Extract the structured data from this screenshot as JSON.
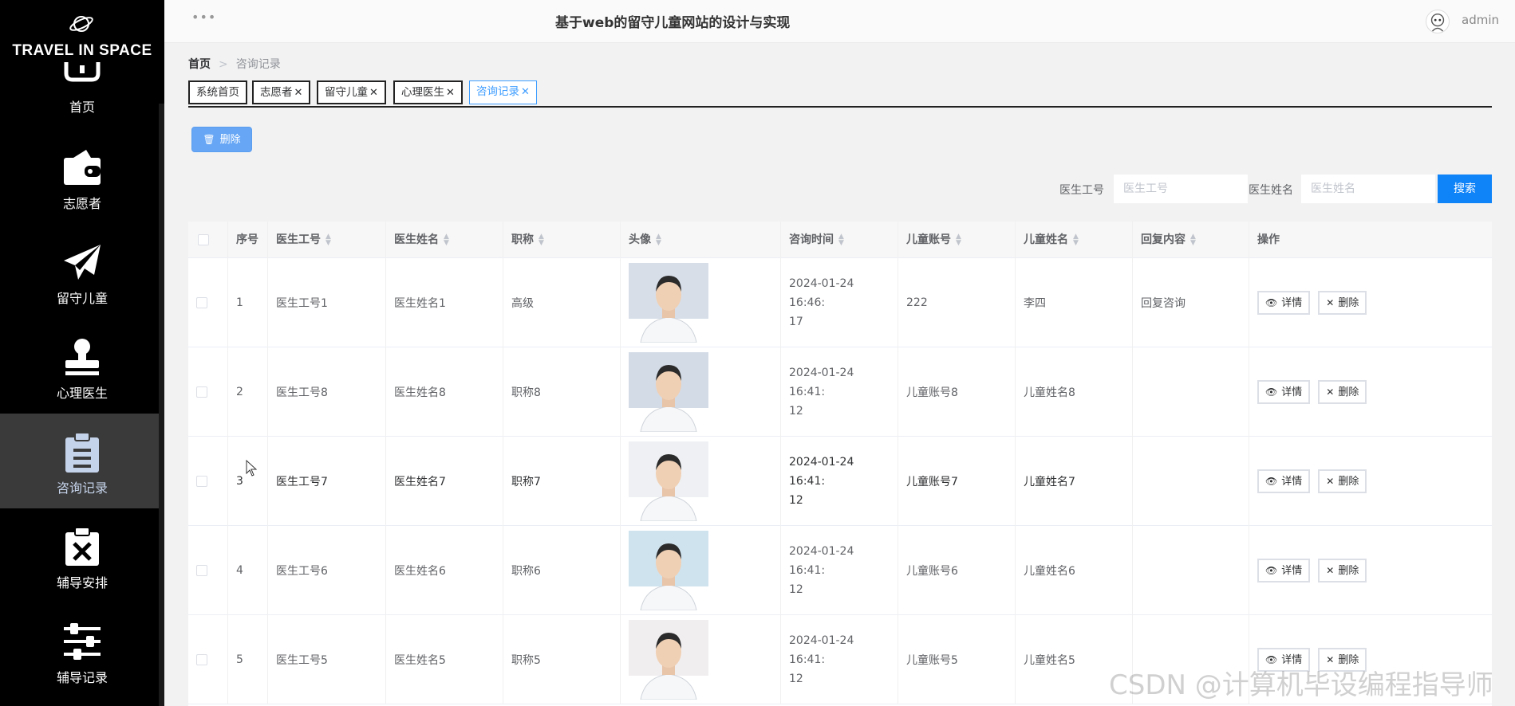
{
  "brand": {
    "title": "TRAVEL IN SPACE",
    "icon": "planet-icon"
  },
  "sidebar": {
    "items": [
      {
        "label": "首页",
        "icon": "home-icon",
        "active": false
      },
      {
        "label": "志愿者",
        "icon": "wallet-icon",
        "active": false
      },
      {
        "label": "留守儿童",
        "icon": "paper-plane-icon",
        "active": false
      },
      {
        "label": "心理医生",
        "icon": "stamp-icon",
        "active": false
      },
      {
        "label": "咨询记录",
        "icon": "clipboard-icon",
        "active": true
      },
      {
        "label": "辅导安排",
        "icon": "clipboard-x-icon",
        "active": false
      },
      {
        "label": "辅导记录",
        "icon": "sliders-icon",
        "active": false
      }
    ]
  },
  "header": {
    "dots": "•••",
    "site_title": "基于web的留守儿童网站的设计与实现",
    "user": "admin"
  },
  "breadcrumb": {
    "home": "首页",
    "separator": ">",
    "current": "咨询记录"
  },
  "tabs": [
    {
      "label": "系统首页",
      "closable": false,
      "active": false
    },
    {
      "label": "志愿者",
      "closable": true,
      "active": false
    },
    {
      "label": "留守儿童",
      "closable": true,
      "active": false
    },
    {
      "label": "心理医生",
      "closable": true,
      "active": false
    },
    {
      "label": "咨询记录",
      "closable": true,
      "active": true
    }
  ],
  "toolbar": {
    "delete_label": "删除",
    "delete_icon": "trash-icon"
  },
  "search": {
    "doctor_id_label": "医生工号",
    "doctor_id_placeholder": "医生工号",
    "doctor_name_label": "医生姓名",
    "doctor_name_placeholder": "医生姓名",
    "button_label": "搜索"
  },
  "table": {
    "columns": [
      "序号",
      "医生工号",
      "医生姓名",
      "职称",
      "头像",
      "咨询时间",
      "儿童账号",
      "儿童姓名",
      "回复内容",
      "操作"
    ],
    "rows": [
      {
        "index": "1",
        "doctor_id": "医生工号1",
        "doctor_name": "医生姓名1",
        "title": "高级",
        "time_line1": "2024-01-24 16:46:",
        "time_line2": "17",
        "child_account": "222",
        "child_name": "李四",
        "reply": "回复咨询"
      },
      {
        "index": "2",
        "doctor_id": "医生工号8",
        "doctor_name": "医生姓名8",
        "title": "职称8",
        "time_line1": "2024-01-24 16:41:",
        "time_line2": "12",
        "child_account": "儿童账号8",
        "child_name": "儿童姓名8",
        "reply": ""
      },
      {
        "index": "3",
        "doctor_id": "医生工号7",
        "doctor_name": "医生姓名7",
        "title": "职称7",
        "time_line1": "2024-01-24 16:41:",
        "time_line2": "12",
        "child_account": "儿童账号7",
        "child_name": "儿童姓名7",
        "reply": ""
      },
      {
        "index": "4",
        "doctor_id": "医生工号6",
        "doctor_name": "医生姓名6",
        "title": "职称6",
        "time_line1": "2024-01-24 16:41:",
        "time_line2": "12",
        "child_account": "儿童账号6",
        "child_name": "儿童姓名6",
        "reply": ""
      },
      {
        "index": "5",
        "doctor_id": "医生工号5",
        "doctor_name": "医生姓名5",
        "title": "职称5",
        "time_line1": "2024-01-24 16:41:",
        "time_line2": "12",
        "child_account": "儿童账号5",
        "child_name": "儿童姓名5",
        "reply": ""
      }
    ],
    "actions": {
      "detail": "详情",
      "detail_icon": "eye-icon",
      "delete": "删除",
      "delete_icon": "close-icon"
    }
  },
  "watermark": "CSDN @计算机毕设编程指导师",
  "colors": {
    "sidebar_bg": "#000000",
    "primary": "#409eff",
    "search_button": "#0f83f8",
    "delete_button": "#66a6f5"
  }
}
